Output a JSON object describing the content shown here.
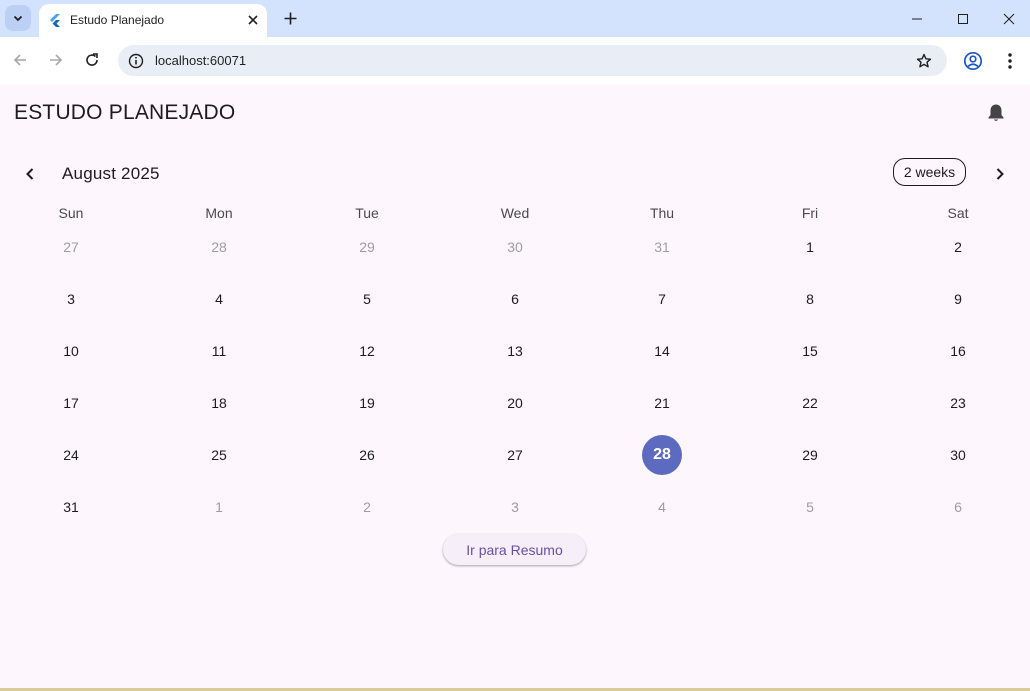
{
  "browser": {
    "tab_title": "Estudo Planejado",
    "url": "localhost:60071"
  },
  "app": {
    "title": "ESTUDO PLANEJADO"
  },
  "calendar": {
    "month_label": "August 2025",
    "format_label": "2 weeks",
    "weekdays": [
      "Sun",
      "Mon",
      "Tue",
      "Wed",
      "Thu",
      "Fri",
      "Sat"
    ],
    "weeks": [
      [
        {
          "d": "27",
          "out": true
        },
        {
          "d": "28",
          "out": true
        },
        {
          "d": "29",
          "out": true
        },
        {
          "d": "30",
          "out": true
        },
        {
          "d": "31",
          "out": true
        },
        {
          "d": "1"
        },
        {
          "d": "2",
          "weekend": true
        }
      ],
      [
        {
          "d": "3",
          "weekend": true
        },
        {
          "d": "4"
        },
        {
          "d": "5"
        },
        {
          "d": "6"
        },
        {
          "d": "7"
        },
        {
          "d": "8"
        },
        {
          "d": "9",
          "weekend": true
        }
      ],
      [
        {
          "d": "10",
          "weekend": true
        },
        {
          "d": "11"
        },
        {
          "d": "12"
        },
        {
          "d": "13"
        },
        {
          "d": "14"
        },
        {
          "d": "15"
        },
        {
          "d": "16",
          "weekend": true
        }
      ],
      [
        {
          "d": "17",
          "weekend": true
        },
        {
          "d": "18"
        },
        {
          "d": "19"
        },
        {
          "d": "20"
        },
        {
          "d": "21"
        },
        {
          "d": "22"
        },
        {
          "d": "23",
          "weekend": true
        }
      ],
      [
        {
          "d": "24",
          "weekend": true
        },
        {
          "d": "25"
        },
        {
          "d": "26"
        },
        {
          "d": "27"
        },
        {
          "d": "28",
          "today": true
        },
        {
          "d": "29"
        },
        {
          "d": "30",
          "weekend": true
        }
      ],
      [
        {
          "d": "31",
          "weekend": true
        },
        {
          "d": "1",
          "out": true
        },
        {
          "d": "2",
          "out": true
        },
        {
          "d": "3",
          "out": true
        },
        {
          "d": "4",
          "out": true
        },
        {
          "d": "5",
          "out": true
        },
        {
          "d": "6",
          "out": true
        }
      ]
    ]
  },
  "actions": {
    "resumo_label": "Ir para Resumo"
  },
  "colors": {
    "today": "#5c6bc0",
    "accent": "#6750a4",
    "background": "#fdf7fd"
  }
}
